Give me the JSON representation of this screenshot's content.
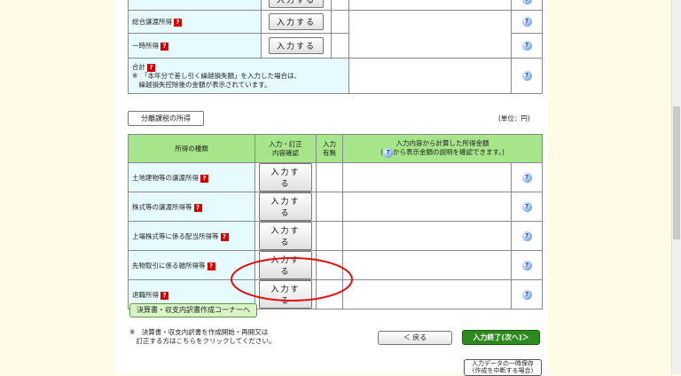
{
  "upper": {
    "rows": [
      {
        "label": "総合譲渡所得",
        "button": "入力する"
      },
      {
        "label": "一時所得",
        "button": "入力する"
      }
    ],
    "total": {
      "label": "合計",
      "note_line1": "※　「本年分で差し引く繰越損失額」を入力した場合は、",
      "note_line2": "　繰越損失控除後の金額が表示されています。"
    }
  },
  "separate": {
    "tab": "分離課税の所得",
    "unit": "(単位：円)",
    "headers": {
      "type": "所得の種類",
      "input_line1": "入力・訂正",
      "input_line2": "内容確認",
      "present_line1": "入力",
      "present_line2": "有無",
      "amount_line1": "入力内容から計算した所得金額",
      "amount_line2_pre": "(",
      "amount_line2_post": "から表示金額の説明を確認できます。)"
    },
    "rows": [
      {
        "label": "土地建物等の譲渡所得",
        "button": "入力する"
      },
      {
        "label": "株式等の譲渡所得等",
        "button": "入力する"
      },
      {
        "label": "上場株式等に係る配当所得等",
        "button": "入力する"
      },
      {
        "label": "先物取引に係る雑所得等",
        "button": "入力する"
      },
      {
        "label": "退職所得",
        "button": "入力する"
      }
    ]
  },
  "footer": {
    "corner_button": "決算書・収支内訳書作成コーナーへ",
    "note_line1": "※　決算書・収支内訳書を作成開始・再開又は",
    "note_line2": "　訂正する方はこちらをクリックしてください。",
    "back_button": "＜ 戻る",
    "next_button": "入力終了(次へ)＞",
    "save_line1": "入力データの一時保存",
    "save_line2": "(作成を中断する場合)"
  },
  "icons": {
    "question": "?",
    "help": "?"
  },
  "colors": {
    "label_bg": "#e6fbff",
    "header_bg": "#a6e58a",
    "circle": "#e01010",
    "next_bg": "#2d8a1e"
  }
}
